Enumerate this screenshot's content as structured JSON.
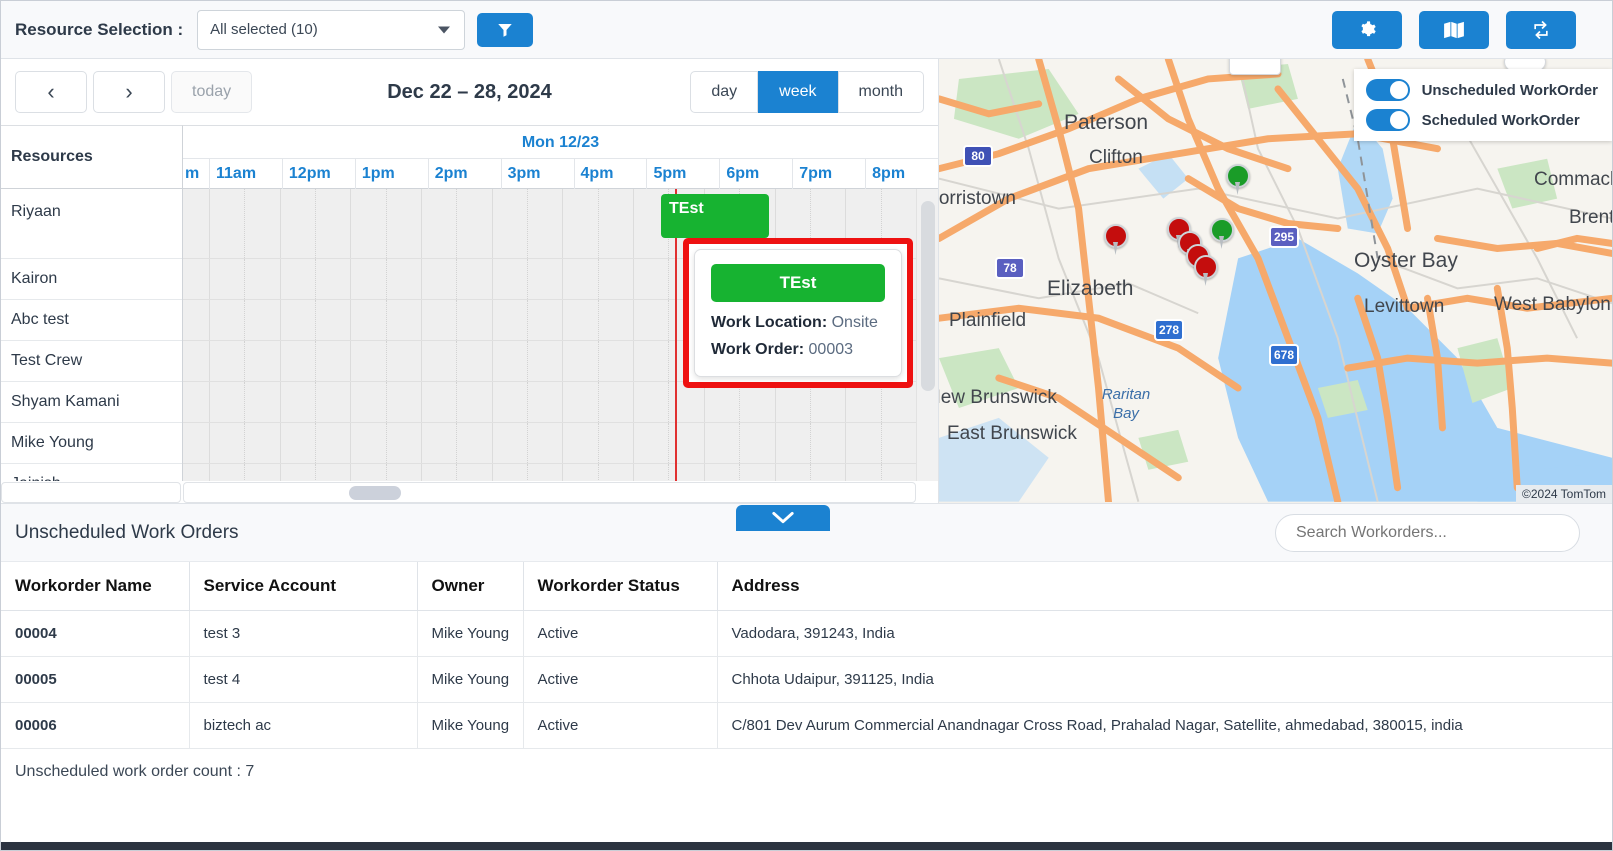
{
  "topbar": {
    "resource_label": "Resource Selection :",
    "resource_selected": "All selected (10)",
    "filter_icon": "filter-icon",
    "settings_icon": "gear-icon",
    "map_icon": "map-icon",
    "refresh_icon": "refresh-icon",
    "accent": "#1b82d1"
  },
  "calendar": {
    "prev_label": "‹",
    "next_label": "›",
    "today_label": "today",
    "title": "Dec 22 – 28, 2024",
    "views": [
      {
        "label": "day",
        "active": false
      },
      {
        "label": "week",
        "active": true
      },
      {
        "label": "month",
        "active": false
      }
    ],
    "resources_header": "Resources",
    "day_label": "Mon 12/23",
    "hours": [
      "m",
      "11am",
      "12pm",
      "1pm",
      "2pm",
      "3pm",
      "4pm",
      "5pm",
      "6pm",
      "7pm",
      "8pm"
    ],
    "resources": [
      "Riyaan",
      "Kairon",
      "Abc test",
      "Test Crew",
      "Shyam Kamani",
      "Mike Young",
      "Jainish"
    ],
    "event": {
      "title": "TEst",
      "color": "#17b331"
    },
    "popup": {
      "title": "TEst",
      "work_location_label": "Work Location:",
      "work_location_value": "Onsite",
      "work_order_label": "Work Order:",
      "work_order_value": "00003",
      "highlight_color": "#ee1111"
    }
  },
  "map": {
    "toggles": [
      {
        "label": "Unscheduled WorkOrder",
        "on": true
      },
      {
        "label": "Scheduled WorkOrder",
        "on": true
      }
    ],
    "cities": [
      "Paterson",
      "Clifton",
      "Morristown",
      "Elizabeth",
      "Plainfield",
      "New Brunswick",
      "East Brunswick",
      "Oyster Bay",
      "Levittown",
      "West Babylon",
      "Commack",
      "Brentwood"
    ],
    "water_label": "Raritan Bay",
    "route_shields": [
      "80",
      "78",
      "278",
      "295",
      "678"
    ],
    "attribution": "©2024 TomTom",
    "pin_colors": {
      "scheduled": "#1a9c28",
      "unscheduled": "#c40d0d"
    }
  },
  "collapse": {
    "icon": "chevron-down-icon"
  },
  "bottom": {
    "title": "Unscheduled Work Orders",
    "search_placeholder": "Search Workorders...",
    "columns": [
      "Workorder Name",
      "Service Account",
      "Owner",
      "Workorder Status",
      "Address"
    ],
    "rows": [
      {
        "name": "00004",
        "account": "test 3",
        "owner": "Mike Young",
        "status": "Active",
        "address": "Vadodara, 391243, India"
      },
      {
        "name": "00005",
        "account": "test 4",
        "owner": "Mike Young",
        "status": "Active",
        "address": "Chhota Udaipur, 391125, India"
      },
      {
        "name": "00006",
        "account": "biztech ac",
        "owner": "Mike Young",
        "status": "Active",
        "address": "C/801 Dev Aurum Commercial Anandnagar Cross Road, Prahalad Nagar, Satellite, ahmedabad, 380015, india"
      }
    ],
    "count_text": "Unscheduled work order count : 7"
  }
}
